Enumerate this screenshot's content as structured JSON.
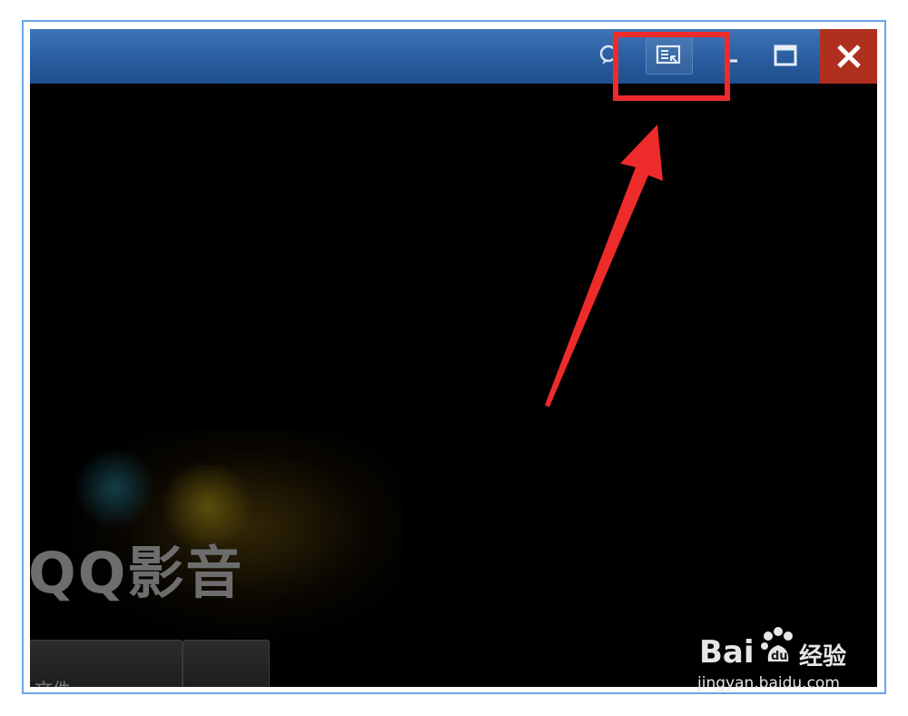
{
  "app": {
    "logo_text": "QQ影音",
    "bottom_button_label": "文件"
  },
  "titlebar": {
    "buttons": [
      {
        "name": "chat-icon"
      },
      {
        "name": "mini-mode-icon"
      },
      {
        "name": "minimize-icon"
      },
      {
        "name": "maximize-icon"
      },
      {
        "name": "close-icon"
      }
    ]
  },
  "annotation": {
    "highlight_color": "#ee2b2b",
    "arrow_color": "#ee2b2b"
  },
  "watermark": {
    "brand": "Bai",
    "brand_suffix": "经验",
    "url": "jingyan.baidu.com"
  },
  "colors": {
    "frame_border": "#6aa6e6",
    "titlebar": "#2a5d9f",
    "close_button": "#b0301f"
  }
}
